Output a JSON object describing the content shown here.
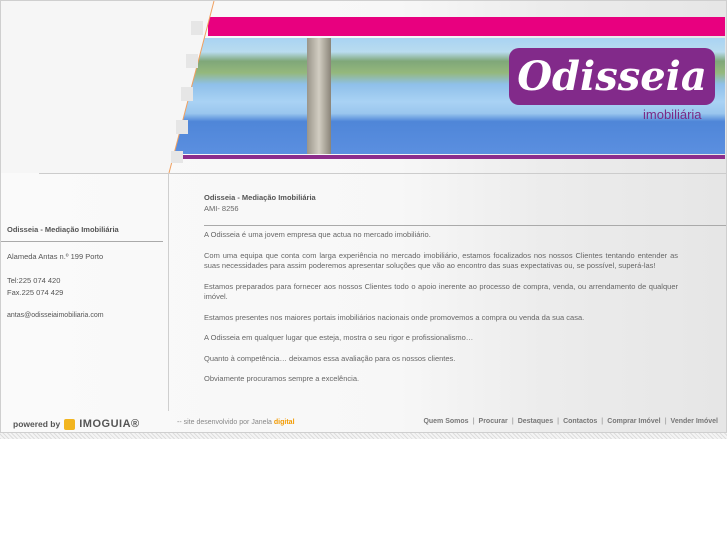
{
  "header": {
    "logo_text": "Odisseia",
    "logo_subtitle": "imobiliária",
    "colors": {
      "pink": "#e8007f",
      "purple": "#822a8a"
    }
  },
  "sidebar": {
    "title": "Odisseia - Mediação Imobiliária",
    "address": "Alameda Antas n.º 199 Porto",
    "tel": "Tel:225 074 420",
    "fax": "Fax.225 074 429",
    "email": "antas@odisseiaimobiliaria.com"
  },
  "main": {
    "title": "Odisseia - Mediação Imobiliária",
    "ami": "AMI- 8256",
    "paragraphs": [
      "A Odisseia é uma jovem empresa que actua no mercado imobiliário.",
      "Com uma equipa que conta com larga experiência no mercado imobiliário, estamos focalizados nos nossos Clientes tentando entender as suas necessidades para assim poderemos apresentar soluções que vão ao encontro das suas expectativas ou, se possível, superá-las!",
      "Estamos preparados para fornecer aos nossos Clientes todo o apoio inerente ao processo de compra, venda, ou arrendamento de qualquer imóvel.",
      "Estamos presentes nos maiores portais imobiliários nacionais onde promovemos a compra ou venda da sua casa.",
      "A Odisseia em qualquer lugar que esteja, mostra o seu rigor e profissionalismo…",
      "Quanto à competência… deixamos essa avaliação para os nossos clientes.",
      "Obviamente procuramos sempre a excelência."
    ]
  },
  "footer": {
    "powered_by": "powered by",
    "imoguia": "IMOGUIA®",
    "dev_prefix": "-- site desenvolvido por Janela",
    "dev_brand": "digital",
    "nav": [
      "Quem Somos",
      "Procurar",
      "Destaques",
      "Contactos",
      "Comprar Imóvel",
      "Vender Imóvel"
    ]
  }
}
